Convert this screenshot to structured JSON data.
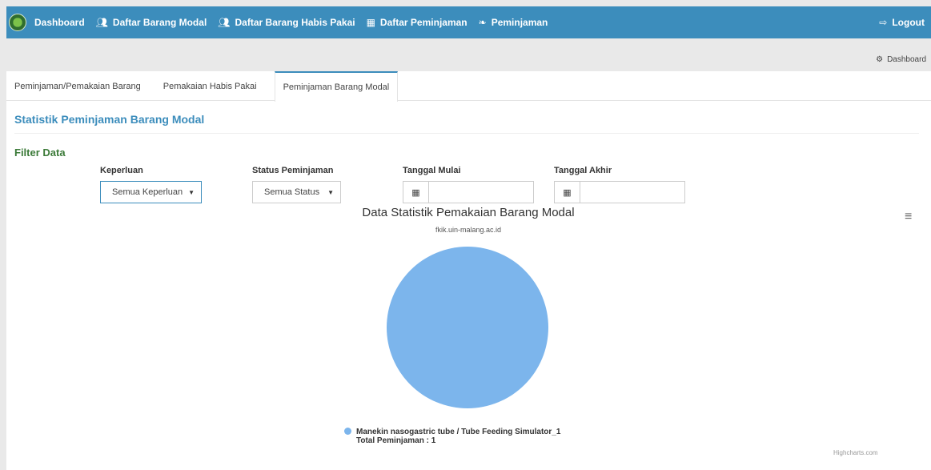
{
  "nav": {
    "items": [
      {
        "label": "Dashboard"
      },
      {
        "icon": "users-group-icon",
        "label": "Daftar Barang Modal"
      },
      {
        "icon": "users-group-icon",
        "label": "Daftar Barang Habis Pakai"
      },
      {
        "icon": "grid-table-icon",
        "label": "Daftar Peminjaman"
      },
      {
        "icon": "leaf-icon",
        "label": "Peminjaman"
      }
    ],
    "logout": "Logout",
    "accent": "#3c8dbc"
  },
  "breadcrumb": {
    "label": "Dashboard",
    "icon": "dashboard-icon"
  },
  "tabs": [
    {
      "label": "Peminjaman/Pemakaian Barang"
    },
    {
      "label": "Pemakaian Habis Pakai"
    },
    {
      "label": "Peminjaman Barang Modal",
      "active": true
    }
  ],
  "section_title": "Statistik Peminjaman Barang Modal",
  "filter": {
    "title": "Filter Data",
    "keperluan": {
      "label": "Keperluan",
      "value": "Semua Keperluan"
    },
    "status": {
      "label": "Status Peminjaman",
      "value": "Semua Status"
    },
    "tanggal_mulai": {
      "label": "Tanggal Mulai",
      "value": ""
    },
    "tanggal_akhir": {
      "label": "Tanggal Akhir",
      "value": ""
    }
  },
  "chart": {
    "credits": "Highcharts.com",
    "legend_line2": "Total Peminjaman : 1"
  },
  "chart_data": {
    "type": "pie",
    "title": "Data Statistik Pemakaian Barang Modal",
    "subtitle": "fkik.uin-malang.ac.id",
    "categories": [
      "Manekin nasogastric tube / Tube Feeding Simulator_1"
    ],
    "values": [
      1
    ],
    "colors": [
      "#7cb5ec"
    ]
  }
}
